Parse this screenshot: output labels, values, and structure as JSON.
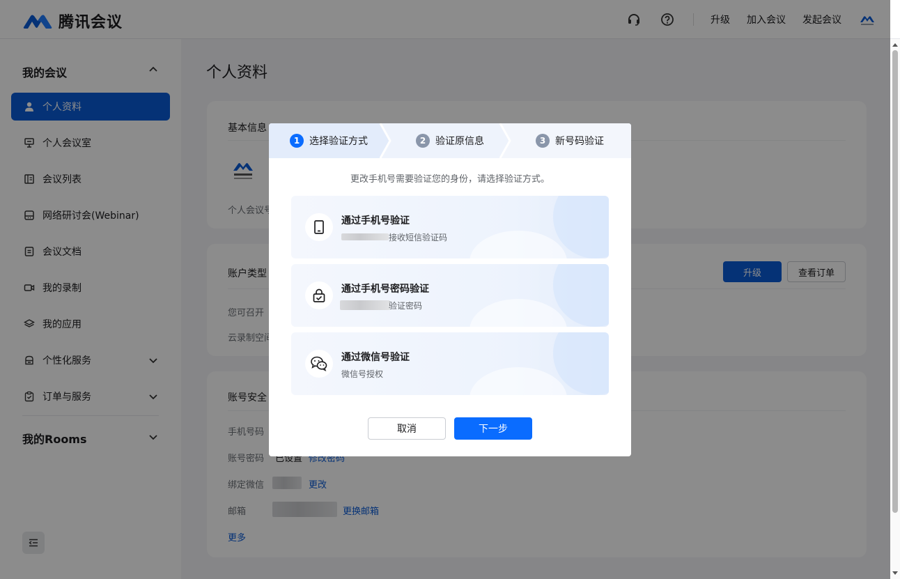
{
  "header": {
    "brand": "腾讯会议",
    "links": [
      "升级",
      "加入会议",
      "发起会议"
    ],
    "icons": [
      "headset-icon",
      "help-icon"
    ]
  },
  "sidebar": {
    "group_my_meetings": "我的会议",
    "items": [
      {
        "label": "个人资料",
        "icon": "user-icon",
        "active": true
      },
      {
        "label": "个人会议室",
        "icon": "monitor-icon"
      },
      {
        "label": "会议列表",
        "icon": "list-icon"
      },
      {
        "label": "网络研讨会(Webinar)",
        "icon": "webinar-icon"
      },
      {
        "label": "会议文档",
        "icon": "document-icon"
      },
      {
        "label": "我的录制",
        "icon": "video-icon"
      },
      {
        "label": "我的应用",
        "icon": "layers-icon"
      },
      {
        "label": "个性化服务",
        "icon": "customize-icon",
        "expandable": true
      },
      {
        "label": "订单与服务",
        "icon": "clipboard-icon",
        "expandable": true
      }
    ],
    "group_rooms": "我的Rooms"
  },
  "main": {
    "page_title": "个人资料",
    "basic_info": {
      "title": "基本信息",
      "meeting_id_label": "个人会议号"
    },
    "account_type": {
      "title": "账户类型",
      "row1_label": "您可召开",
      "row2_label": "云录制空间",
      "upgrade_btn": "升级",
      "orders_btn": "查看订单"
    },
    "security": {
      "title": "账号安全",
      "phone_label": "手机号码",
      "password_label": "账号密码",
      "password_value": "已设置",
      "password_link": "修改密码",
      "wechat_label": "绑定微信",
      "wechat_link": "更改",
      "email_label": "邮箱",
      "email_link": "更换邮箱",
      "more_link": "更多"
    }
  },
  "dialog": {
    "steps": [
      {
        "num": "1",
        "label": "选择验证方式",
        "active": true
      },
      {
        "num": "2",
        "label": "验证原信息"
      },
      {
        "num": "3",
        "label": "新号码验证"
      }
    ],
    "hint": "更改手机号需要验证您的身份，请选择验证方式。",
    "options": [
      {
        "title": "通过手机号验证",
        "subtitle": "接收短信验证码",
        "icon": "phone-icon"
      },
      {
        "title": "通过手机号密码验证",
        "subtitle": "验证密码",
        "icon": "lock-icon"
      },
      {
        "title": "通过微信号验证",
        "subtitle": "微信号授权",
        "icon": "wechat-icon"
      }
    ],
    "cancel": "取消",
    "next": "下一步"
  },
  "colors": {
    "primary": "#0a5bd8",
    "dialog_primary": "#0a6cff",
    "step_active": "#0a6cff",
    "step_inactive": "#8a96aa"
  }
}
